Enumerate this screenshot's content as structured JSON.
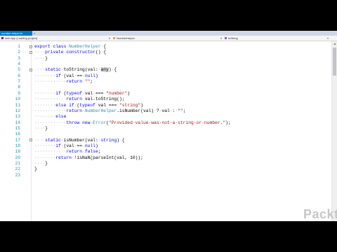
{
  "tabs": [
    {
      "label": "number-helper.ts",
      "active": true
    },
    {
      "label": "",
      "active": false
    }
  ],
  "nav": {
    "project": "web.app (Loading project)",
    "class": "NumberHelper",
    "member": "toString"
  },
  "code_lines": [
    {
      "n": "1",
      "segs": [
        [
          "kw",
          "export"
        ],
        [
          "ws",
          "·"
        ],
        [
          "kw",
          "class"
        ],
        [
          "ws",
          "·"
        ],
        [
          "ty",
          "NumberHelper"
        ],
        [
          "ws",
          "·"
        ],
        [
          "",
          "{"
        ]
      ]
    },
    {
      "n": "2",
      "segs": [
        [
          "ws",
          "····"
        ],
        [
          "kw",
          "private"
        ],
        [
          "ws",
          "·"
        ],
        [
          "kw",
          "constructor"
        ],
        [
          "",
          "()"
        ],
        [
          "ws",
          "·"
        ],
        [
          "",
          "{"
        ]
      ]
    },
    {
      "n": "3",
      "segs": [
        [
          "ws",
          "····"
        ],
        [
          "",
          "}"
        ]
      ]
    },
    {
      "n": "4",
      "segs": []
    },
    {
      "n": "5",
      "segs": [
        [
          "ws",
          "····"
        ],
        [
          "kw",
          "static"
        ],
        [
          "ws",
          "·"
        ],
        [
          "",
          "toString(val:"
        ],
        [
          "ws",
          "·"
        ],
        [
          "hl",
          "any"
        ],
        [
          "",
          ")"
        ],
        [
          "ws",
          "·"
        ],
        [
          "",
          "{"
        ]
      ]
    },
    {
      "n": "6",
      "segs": [
        [
          "ws",
          "········"
        ],
        [
          "kw",
          "if"
        ],
        [
          "ws",
          "·"
        ],
        [
          "",
          "(val"
        ],
        [
          "ws",
          "·"
        ],
        [
          "",
          "=="
        ],
        [
          "ws",
          "·"
        ],
        [
          "kw",
          "null"
        ],
        [
          "",
          ")"
        ]
      ]
    },
    {
      "n": "7",
      "segs": [
        [
          "ws",
          "············"
        ],
        [
          "kw",
          "return"
        ],
        [
          "ws",
          "·"
        ],
        [
          "str",
          "\"\""
        ],
        [
          "",
          ";"
        ]
      ]
    },
    {
      "n": "8",
      "segs": []
    },
    {
      "n": "9",
      "segs": [
        [
          "ws",
          "········"
        ],
        [
          "kw",
          "if"
        ],
        [
          "ws",
          "·"
        ],
        [
          "",
          "("
        ],
        [
          "kw",
          "typeof"
        ],
        [
          "ws",
          "·"
        ],
        [
          "",
          "val"
        ],
        [
          "ws",
          "·"
        ],
        [
          "",
          "==="
        ],
        [
          "ws",
          "·"
        ],
        [
          "str",
          "\"number\""
        ],
        [
          "",
          ")"
        ]
      ]
    },
    {
      "n": "10",
      "segs": [
        [
          "ws",
          "············"
        ],
        [
          "kw",
          "return"
        ],
        [
          "ws",
          "·"
        ],
        [
          "",
          "val.toString();"
        ]
      ]
    },
    {
      "n": "11",
      "segs": [
        [
          "ws",
          "········"
        ],
        [
          "kw",
          "else"
        ],
        [
          "ws",
          "·"
        ],
        [
          "kw",
          "if"
        ],
        [
          "ws",
          "·"
        ],
        [
          "",
          "("
        ],
        [
          "kw",
          "typeof"
        ],
        [
          "ws",
          "·"
        ],
        [
          "",
          "val"
        ],
        [
          "ws",
          "·"
        ],
        [
          "",
          "==="
        ],
        [
          "ws",
          "·"
        ],
        [
          "str",
          "\"string\""
        ],
        [
          "",
          ")"
        ]
      ]
    },
    {
      "n": "12",
      "segs": [
        [
          "ws",
          "············"
        ],
        [
          "kw",
          "return"
        ],
        [
          "ws",
          "·"
        ],
        [
          "ty",
          "NumberHelper"
        ],
        [
          "",
          ".isNumber(val)"
        ],
        [
          "ws",
          "·"
        ],
        [
          "",
          "?"
        ],
        [
          "ws",
          "·"
        ],
        [
          "",
          "val"
        ],
        [
          "ws",
          "·"
        ],
        [
          "",
          ":"
        ],
        [
          "ws",
          "·"
        ],
        [
          "str",
          "\"\""
        ],
        [
          "",
          ";"
        ]
      ]
    },
    {
      "n": "13",
      "segs": [
        [
          "ws",
          "········"
        ],
        [
          "kw",
          "else"
        ]
      ]
    },
    {
      "n": "14",
      "segs": [
        [
          "ws",
          "············"
        ],
        [
          "kw",
          "throw"
        ],
        [
          "ws",
          "·"
        ],
        [
          "kw",
          "new"
        ],
        [
          "ws",
          "·"
        ],
        [
          "ty",
          "Error"
        ],
        [
          "",
          "("
        ],
        [
          "str",
          "\"Provided·value·was·not·a·string·or·number.\""
        ],
        [
          "",
          ");"
        ]
      ]
    },
    {
      "n": "15",
      "segs": [
        [
          "ws",
          "····"
        ],
        [
          "",
          "}"
        ]
      ]
    },
    {
      "n": "16",
      "segs": []
    },
    {
      "n": "17",
      "segs": [
        [
          "ws",
          "····"
        ],
        [
          "kw",
          "static"
        ],
        [
          "ws",
          "·"
        ],
        [
          "",
          "isNumber(val:"
        ],
        [
          "ws",
          "·"
        ],
        [
          "kw",
          "string"
        ],
        [
          "",
          ")"
        ],
        [
          "ws",
          "·"
        ],
        [
          "",
          "{"
        ]
      ]
    },
    {
      "n": "18",
      "segs": [
        [
          "ws",
          "········"
        ],
        [
          "kw",
          "if"
        ],
        [
          "ws",
          "·"
        ],
        [
          "",
          "(val"
        ],
        [
          "ws",
          "·"
        ],
        [
          "",
          "=="
        ],
        [
          "ws",
          "·"
        ],
        [
          "kw",
          "null"
        ],
        [
          "",
          ")"
        ]
      ]
    },
    {
      "n": "19",
      "segs": [
        [
          "ws",
          "············"
        ],
        [
          "kw",
          "return"
        ],
        [
          "ws",
          "·"
        ],
        [
          "kw",
          "false"
        ],
        [
          "",
          ";"
        ]
      ]
    },
    {
      "n": "20",
      "segs": [
        [
          "ws",
          "········"
        ],
        [
          "kw",
          "return"
        ],
        [
          "ws",
          "·"
        ],
        [
          "",
          "!isNaN(parseInt(val,"
        ],
        [
          "ws",
          "·"
        ],
        [
          "",
          "10));"
        ]
      ]
    },
    {
      "n": "21",
      "segs": [
        [
          "ws",
          "····"
        ],
        [
          "",
          "}"
        ]
      ]
    },
    {
      "n": "22",
      "segs": [
        [
          "",
          "}"
        ]
      ]
    },
    {
      "n": "23",
      "segs": []
    }
  ],
  "folds": {
    "1": "−",
    "2": "−",
    "5": "−",
    "17": "−"
  },
  "watermark": "Packt>"
}
